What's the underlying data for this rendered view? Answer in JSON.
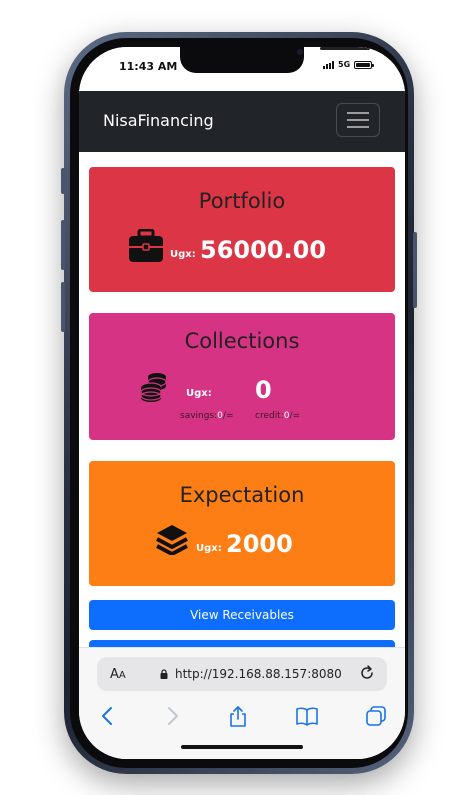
{
  "status": {
    "time": "11:43 AM",
    "network": "5G"
  },
  "navbar": {
    "brand": "NisaFinancing"
  },
  "cards": {
    "portfolio": {
      "title": "Portfolio",
      "currency": "Ugx:",
      "value": "56000.00",
      "bg": "#dc3545",
      "icon": "briefcase-icon"
    },
    "collections": {
      "title": "Collections",
      "currency": "Ugx:",
      "value": "0",
      "savings_label": "savings:",
      "savings_value": "0",
      "savings_suffix": "/=",
      "credit_label": "credit:",
      "credit_value": "0",
      "credit_suffix": "/=",
      "bg": "#d63384",
      "icon": "coins-icon"
    },
    "expectation": {
      "title": "Expectation",
      "currency": "Ugx:",
      "value": "2000",
      "bg": "#fd7e14",
      "icon": "layers-icon"
    }
  },
  "buttons": {
    "view_receivables": "View Receivables",
    "color": "#0d6efd"
  },
  "browser": {
    "text_size_label": "A",
    "text_size_label_large": "A",
    "url": "http://192.168.88.157:8080",
    "toolbar": [
      "back-icon",
      "forward-icon",
      "share-icon",
      "bookmarks-icon",
      "tabs-icon"
    ]
  }
}
